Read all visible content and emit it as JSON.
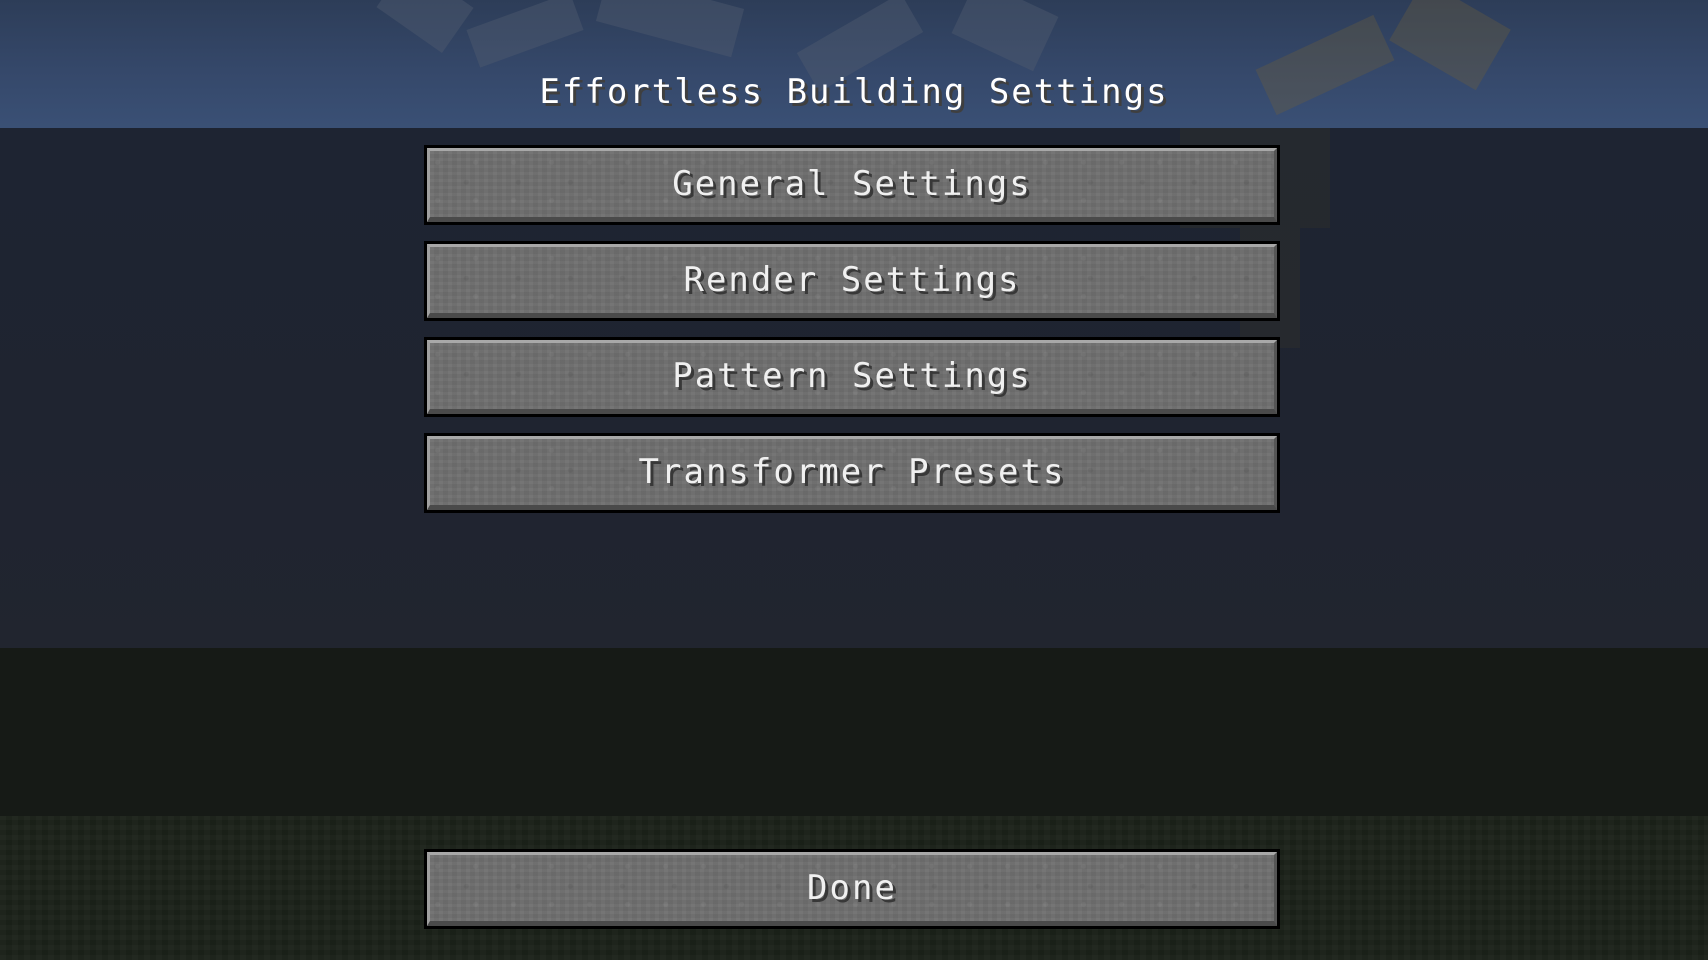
{
  "screen": {
    "title": "Effortless Building Settings"
  },
  "menu": {
    "items": [
      {
        "label": "General Settings"
      },
      {
        "label": "Render Settings"
      },
      {
        "label": "Pattern Settings"
      },
      {
        "label": "Transformer Presets"
      }
    ]
  },
  "footer": {
    "done_label": "Done"
  },
  "colors": {
    "button_face": "#6f6f6f",
    "button_border": "#000000",
    "text": "#ffffff",
    "sky": "#35486a",
    "dim_overlay": "#1f2430"
  }
}
